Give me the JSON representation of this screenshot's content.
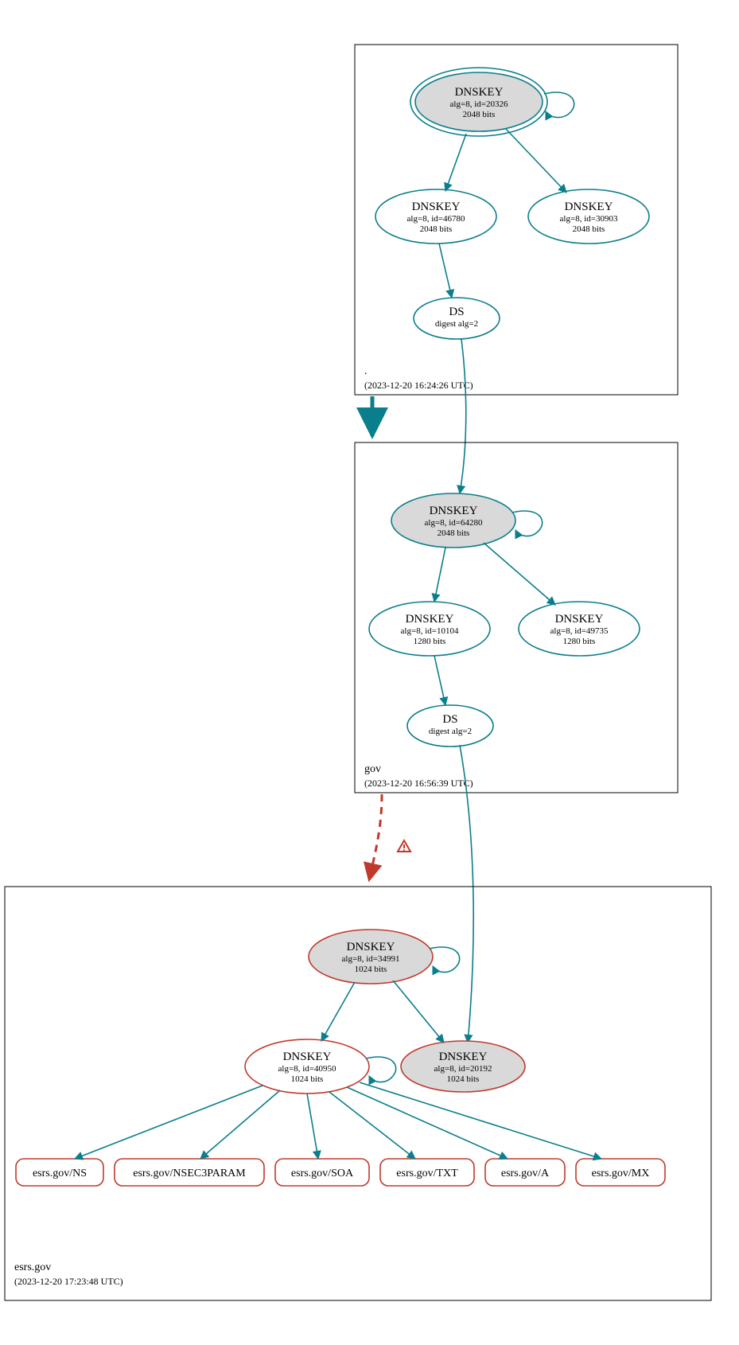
{
  "colors": {
    "teal": "#0a7e8c",
    "red": "#c0392b",
    "gray_fill": "#d9d9d9",
    "white": "#ffffff",
    "black": "#000000",
    "box": "#000000"
  },
  "zones": {
    "root": {
      "label": ".",
      "timestamp": "(2023-12-20 16:24:26 UTC)",
      "nodes": {
        "ksk": {
          "title": "DNSKEY",
          "line2": "alg=8, id=20326",
          "line3": "2048 bits"
        },
        "zsk1": {
          "title": "DNSKEY",
          "line2": "alg=8, id=46780",
          "line3": "2048 bits"
        },
        "zsk2": {
          "title": "DNSKEY",
          "line2": "alg=8, id=30903",
          "line3": "2048 bits"
        },
        "ds": {
          "title": "DS",
          "line2": "digest alg=2"
        }
      }
    },
    "gov": {
      "label": "gov",
      "timestamp": "(2023-12-20 16:56:39 UTC)",
      "nodes": {
        "ksk": {
          "title": "DNSKEY",
          "line2": "alg=8, id=64280",
          "line3": "2048 bits"
        },
        "zsk1": {
          "title": "DNSKEY",
          "line2": "alg=8, id=10104",
          "line3": "1280 bits"
        },
        "zsk2": {
          "title": "DNSKEY",
          "line2": "alg=8, id=49735",
          "line3": "1280 bits"
        },
        "ds": {
          "title": "DS",
          "line2": "digest alg=2"
        }
      }
    },
    "esrs": {
      "label": "esrs.gov",
      "timestamp": "(2023-12-20 17:23:48 UTC)",
      "nodes": {
        "ksk": {
          "title": "DNSKEY",
          "line2": "alg=8, id=34991",
          "line3": "1024 bits"
        },
        "zsk": {
          "title": "DNSKEY",
          "line2": "alg=8, id=40950",
          "line3": "1024 bits"
        },
        "dormant": {
          "title": "DNSKEY",
          "line2": "alg=8, id=20192",
          "line3": "1024 bits"
        }
      },
      "rrsets": {
        "ns": "esrs.gov/NS",
        "n3p": "esrs.gov/NSEC3PARAM",
        "soa": "esrs.gov/SOA",
        "txt": "esrs.gov/TXT",
        "a": "esrs.gov/A",
        "mx": "esrs.gov/MX"
      }
    }
  },
  "warning_glyph": "⚠"
}
